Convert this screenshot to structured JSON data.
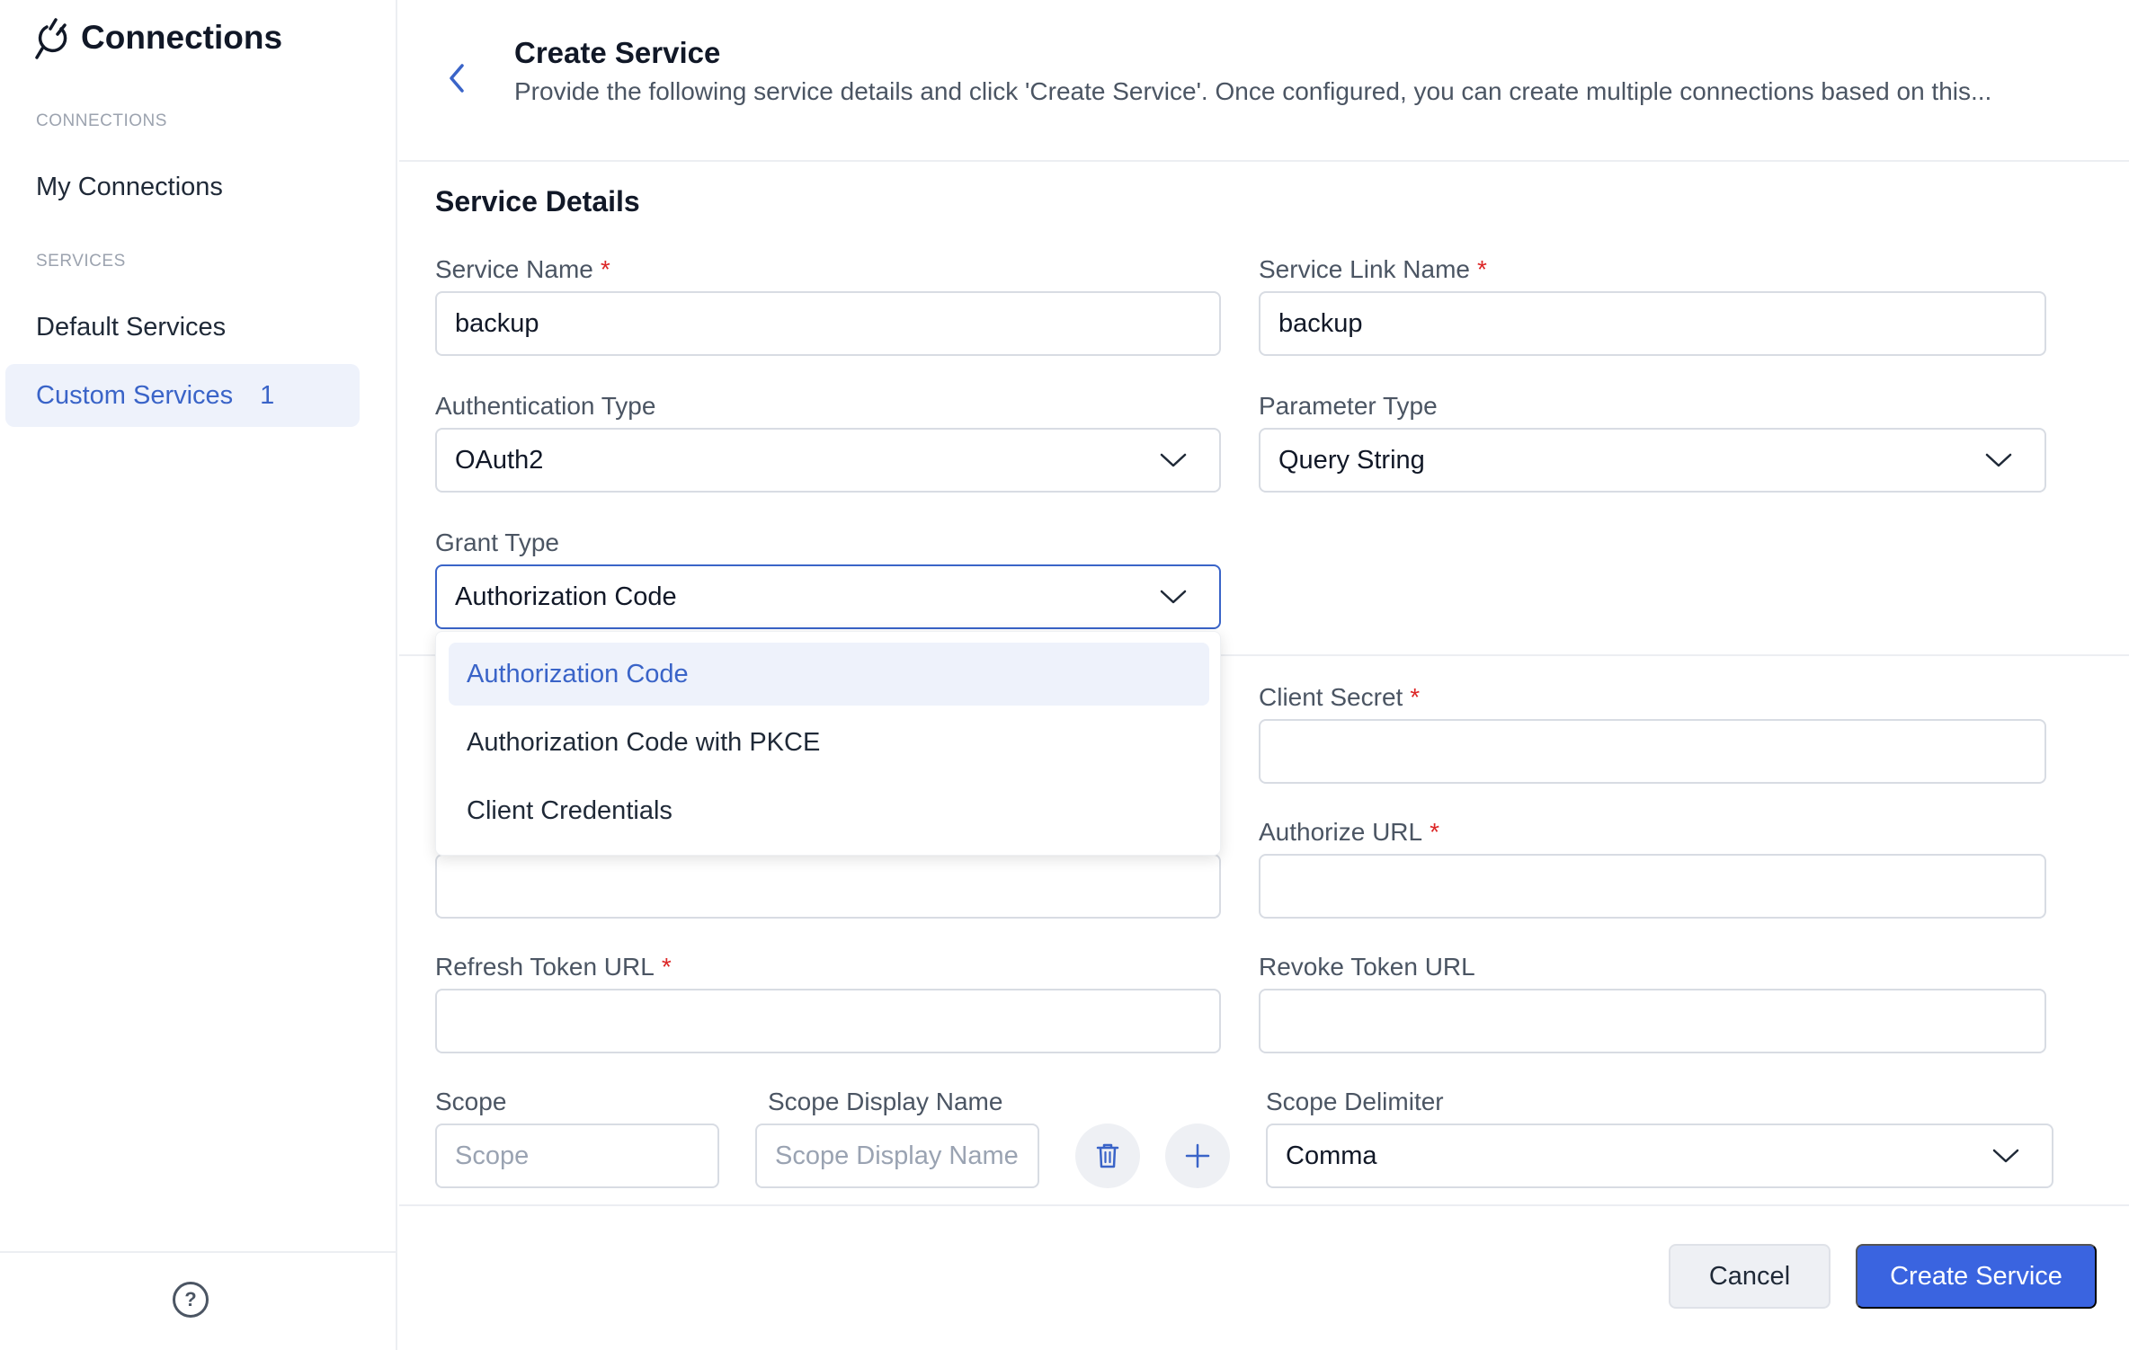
{
  "sidebar": {
    "app_title": "Connections",
    "section_connections": "CONNECTIONS",
    "my_connections": "My Connections",
    "section_services": "SERVICES",
    "default_services": "Default Services",
    "custom_services": "Custom Services",
    "custom_services_count": "1",
    "help_icon": "?"
  },
  "header": {
    "title": "Create Service",
    "subtitle": "Provide the following service details and click 'Create Service'. Once configured, you can create multiple connections based on this..."
  },
  "form": {
    "section_title": "Service Details",
    "required_mark": "*",
    "service_name": {
      "label": "Service Name",
      "value": "backup"
    },
    "service_link_name": {
      "label": "Service Link Name",
      "value": "backup"
    },
    "authentication_type": {
      "label": "Authentication Type",
      "value": "OAuth2"
    },
    "parameter_type": {
      "label": "Parameter Type",
      "value": "Query String"
    },
    "grant_type": {
      "label": "Grant Type",
      "value": "Authorization Code",
      "options": [
        "Authorization Code",
        "Authorization Code with PKCE",
        "Client Credentials"
      ]
    },
    "client_secret": {
      "label": "Client Secret",
      "value": ""
    },
    "authorize_url": {
      "label": "Authorize URL",
      "value": ""
    },
    "refresh_token_url": {
      "label": "Refresh Token URL",
      "value": ""
    },
    "revoke_token_url": {
      "label": "Revoke Token URL",
      "value": ""
    },
    "scope": {
      "label": "Scope",
      "placeholder": "Scope"
    },
    "scope_display_name": {
      "label": "Scope Display Name",
      "placeholder": "Scope Display Name"
    },
    "scope_delimiter": {
      "label": "Scope Delimiter",
      "value": "Comma"
    }
  },
  "footer": {
    "cancel": "Cancel",
    "create": "Create Service"
  },
  "colors": {
    "accent": "#3a64e0",
    "active_bg": "#eef2fb",
    "required": "#dc2626"
  }
}
